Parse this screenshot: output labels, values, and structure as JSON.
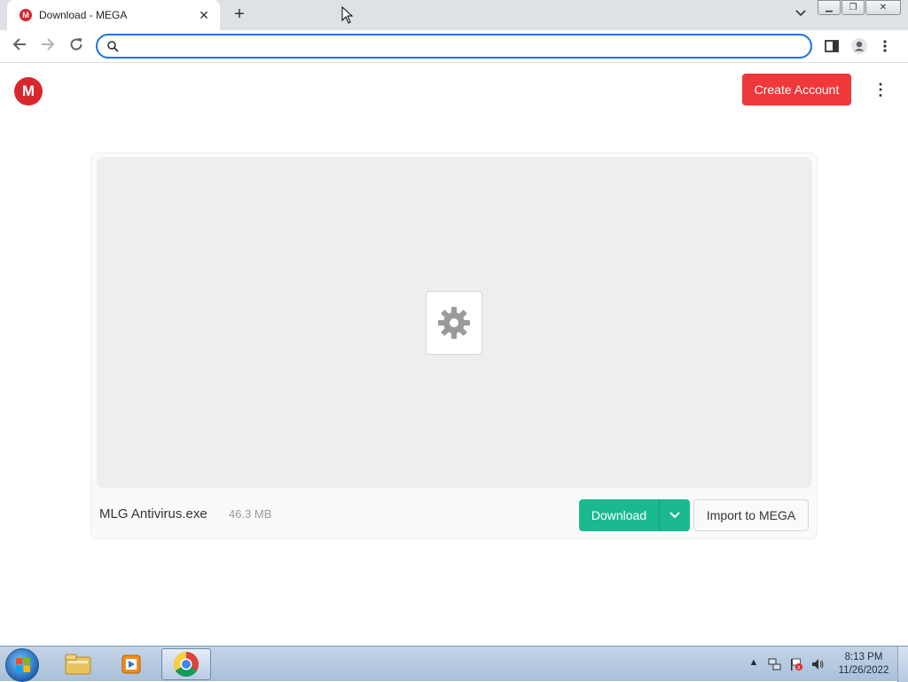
{
  "browser": {
    "tab": {
      "title": "Download - MEGA",
      "favicon": "M"
    },
    "omnibox": {
      "value": "",
      "placeholder": ""
    }
  },
  "page": {
    "logo": "M",
    "create_account_label": "Create Account",
    "file": {
      "name": "MLG Antivirus.exe",
      "size": "46.3 MB"
    },
    "download_label": "Download",
    "import_label": "Import to MEGA"
  },
  "taskbar": {
    "clock": {
      "time": "8:13 PM",
      "date": "11/26/2022"
    }
  },
  "colors": {
    "mega_red": "#d9272e",
    "create_account_bg": "#f0373a",
    "download_green": "#1bb98f",
    "omnibox_focus": "#1a73e8"
  },
  "icons": [
    "mega-favicon-icon",
    "close-icon",
    "plus-icon",
    "chevron-down-icon",
    "back-icon",
    "forward-icon",
    "reload-icon",
    "search-icon",
    "side-panel-icon",
    "profile-icon",
    "kebab-menu-icon",
    "gear-icon",
    "windows-start-icon",
    "explorer-icon",
    "media-player-icon",
    "chrome-icon",
    "network-icon",
    "flag-icon",
    "volume-icon"
  ]
}
